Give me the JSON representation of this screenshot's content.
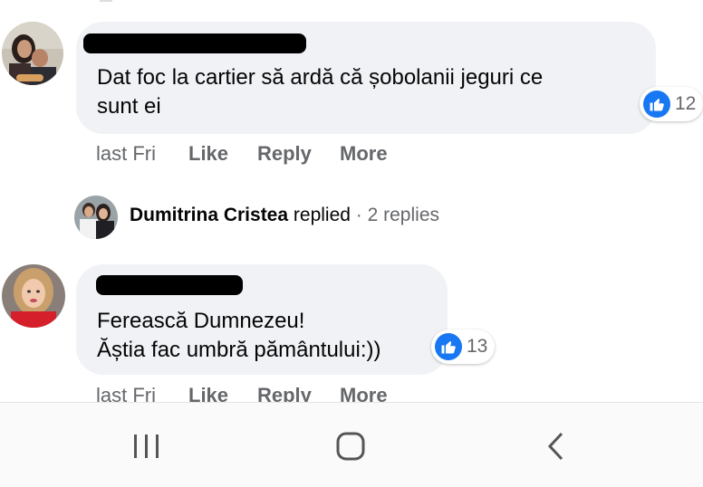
{
  "comments": [
    {
      "text": "Dat foc la cartier să ardă că șobolanii jeguri ce\nsunt ei",
      "reactions": "12",
      "timestamp": "last Fri",
      "like": "Like",
      "reply": "Reply",
      "more": "More"
    },
    {
      "text": "Ferească Dumnezeu!\nĂștia fac umbră pământului:))",
      "reactions": "13",
      "timestamp": "last Fri",
      "like": "Like",
      "reply": "Reply",
      "more": "More"
    }
  ],
  "replies": {
    "name": "Dumitrina Cristea",
    "replied": "replied",
    "separator": "·",
    "count": "2 replies"
  },
  "colors": {
    "bubble": "#f0f2f5",
    "like_blue": "#1877f2",
    "muted_text": "#65676b"
  },
  "nav": {
    "recents": "recents-icon",
    "home": "home-icon",
    "back": "back-icon"
  }
}
